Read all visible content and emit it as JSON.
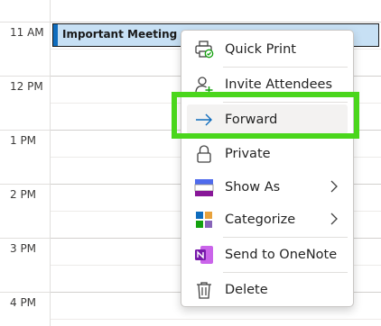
{
  "time_labels": [
    "11 AM",
    "12 PM",
    "1 PM",
    "2 PM",
    "3 PM",
    "4 PM"
  ],
  "event": {
    "title": "Important Meeting"
  },
  "menu": {
    "items": [
      {
        "label": "Quick Print",
        "icon": "quick-print-icon"
      },
      {
        "label": "Invite Attendees",
        "icon": "invite-attendees-icon"
      },
      {
        "label": "Forward",
        "icon": "forward-arrow-icon"
      },
      {
        "label": "Private",
        "icon": "lock-icon"
      },
      {
        "label": "Show As",
        "icon": "show-as-icon",
        "submenu": true
      },
      {
        "label": "Categorize",
        "icon": "categorize-icon",
        "submenu": true
      },
      {
        "label": "Send to OneNote",
        "icon": "onenote-icon"
      },
      {
        "label": "Delete",
        "icon": "trash-icon"
      }
    ]
  },
  "colors": {
    "event_fill": "#c7e0f4",
    "event_accent": "#0f6cbd",
    "highlight": "#4ad61c",
    "onenote": "#7719aa"
  }
}
